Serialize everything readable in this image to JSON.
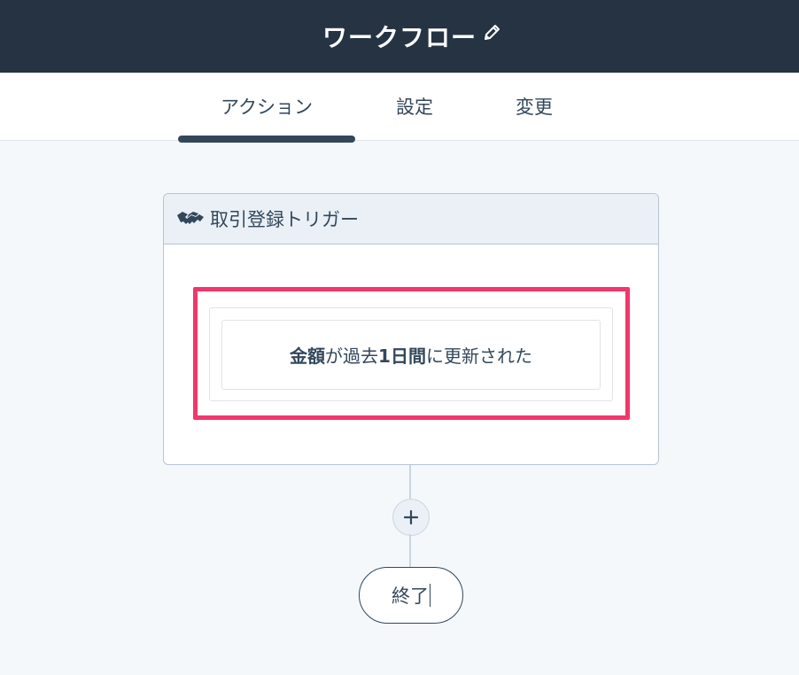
{
  "header": {
    "title": "ワークフロー",
    "edit_icon": "pencil-icon",
    "background_color": "#253342"
  },
  "tabs": [
    {
      "label": "アクション",
      "active": true
    },
    {
      "label": "設定",
      "active": false
    },
    {
      "label": "変更",
      "active": false
    }
  ],
  "trigger": {
    "icon": "handshake-icon",
    "title": "取引登録トリガー",
    "condition": {
      "field": "金額",
      "connector1": "が過去",
      "period": "1日間",
      "connector2": "に更新された"
    },
    "highlight_color": "#f2366b"
  },
  "add_step": {
    "icon": "plus-icon"
  },
  "end_node": {
    "label": "終了"
  }
}
